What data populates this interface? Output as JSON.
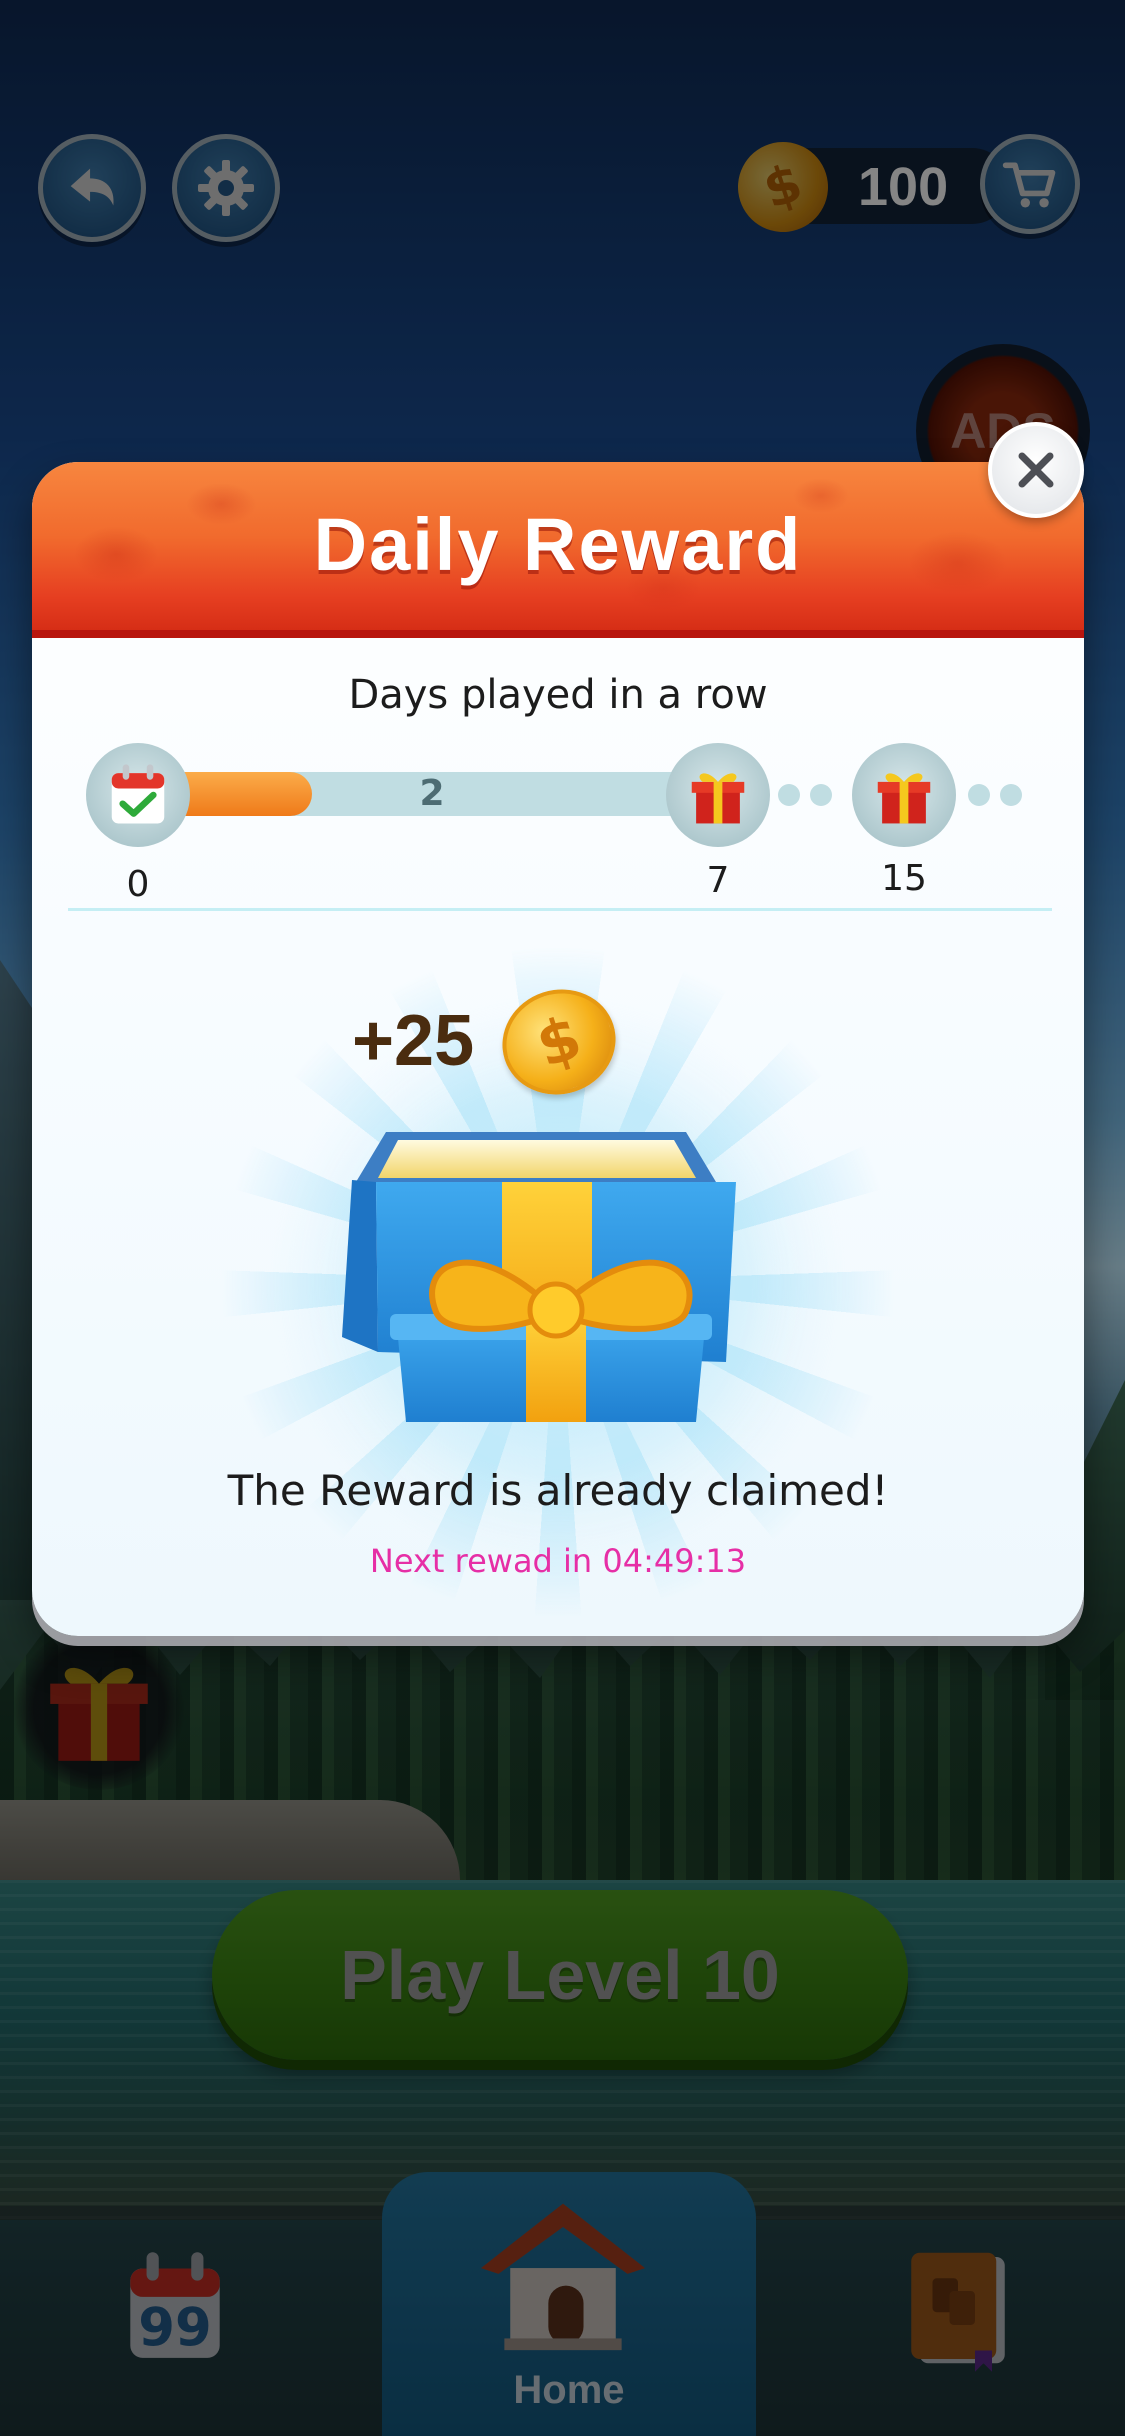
{
  "coins": {
    "count": "100"
  },
  "ads_button": {
    "label": "ADS"
  },
  "modal": {
    "title": "Daily Reward",
    "streak_label": "Days played in a row",
    "progress": {
      "current_value": "2",
      "fill_fraction": 0.29,
      "milestones": [
        "0",
        "7",
        "15"
      ]
    },
    "reward_amount": "+25",
    "claimed_message": "The Reward is already claimed!",
    "next_reward_message": "Next rewad in 04:49:13"
  },
  "play_button": {
    "label": "Play Level 10"
  },
  "bottom_nav": {
    "items": [
      {
        "icon": "calendar-quote-icon",
        "label": ""
      },
      {
        "icon": "house-icon",
        "label": "Home"
      },
      {
        "icon": "book-icon",
        "label": ""
      }
    ]
  },
  "colors": {
    "header_red": "#e63f21",
    "progress_orange": "#ef7a19",
    "next_reward_pink": "#e62fa6",
    "play_green": "#3b8313"
  }
}
